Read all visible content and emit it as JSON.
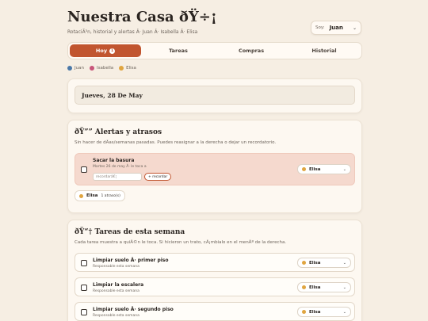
{
  "header": {
    "title": "Nuestra Casa ðŸ÷¡",
    "subtitle": "RotaciÃ³n, historial y alertas Â· Juan Â· Isabella Â· Elisa",
    "user_label": "Soy:",
    "user_value": "Juan"
  },
  "tabs": [
    {
      "label": "Hoy",
      "badge": "1"
    },
    {
      "label": "Tareas"
    },
    {
      "label": "Compras"
    },
    {
      "label": "Historial"
    }
  ],
  "legend": [
    {
      "name": "Juan",
      "color": "#4a78a8"
    },
    {
      "name": "Isabella",
      "color": "#c8557a"
    },
    {
      "name": "Elisa",
      "color": "#e0a540"
    }
  ],
  "today": {
    "date": "Jueves, 28 De May"
  },
  "alerts": {
    "title": "ðŸ”” Alertas y atrasos",
    "subtitle": "Sin hacer de dÃ­as/semanas pasadas. Puedes reasignar a la derecha o dejar un recordatorio.",
    "item": {
      "title": "Sacar la basura",
      "meta": "Martes 26 de may Â· le toca a",
      "remind_placeholder": "recordarâ€¦",
      "remind_button": "+ recordar",
      "assignee": "Elisa"
    },
    "overdue": {
      "name": "Elisa",
      "count": "1 atraso(s)"
    }
  },
  "week": {
    "title": "ðŸ“† Tareas de esta semana",
    "subtitle": "Cada tarea muestra a quiÃ©n le toca. Si hicieron un trato, cÃ¡mbialo en el menÃº de la derecha.",
    "tasks": [
      {
        "title": "Limpiar suelo Â· primer piso",
        "sub": "Responsable esta semana",
        "assignee": "Elisa"
      },
      {
        "title": "Limpiar la escalera",
        "sub": "Responsable esta semana",
        "assignee": "Elisa"
      },
      {
        "title": "Limpiar suelo Â· segundo piso",
        "sub": "Responsable esta semana",
        "assignee": "Elisa"
      }
    ]
  },
  "icons": {
    "chevron": "chevron-down-icon",
    "checkbox": "checkbox-icon"
  }
}
